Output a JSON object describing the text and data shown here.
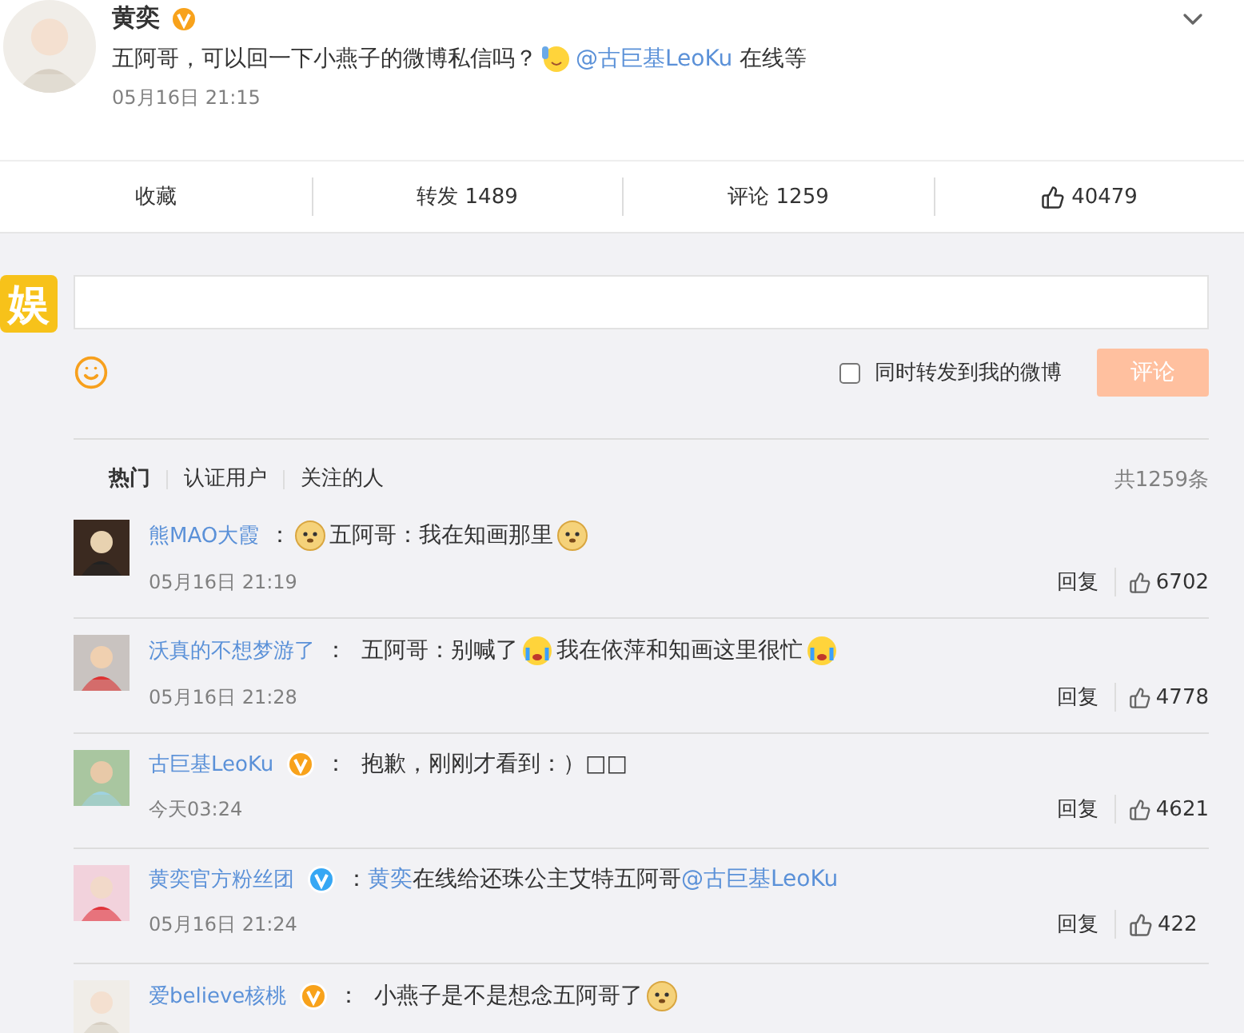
{
  "post": {
    "author": "黄奕",
    "verified": true,
    "color": "#f8a21b",
    "parts": [
      {
        "kind": "text",
        "text": "五阿哥，可以回一下小燕子的微博私信吗？"
      },
      {
        "kind": "wave"
      },
      {
        "kind": "mention",
        "text": "@古巨基LeoKu"
      },
      {
        "kind": "text",
        "text": " 在线等"
      }
    ],
    "time": "05月16日 21:15"
  },
  "actions": [
    {
      "kind": "text",
      "label": "收藏"
    },
    {
      "kind": "text",
      "label": "转发 1489"
    },
    {
      "kind": "text",
      "label": "评论 1259"
    },
    {
      "kind": "like",
      "label": "40479"
    }
  ],
  "composer": {
    "logo": "娱",
    "share_label": "同时转发到我的微博",
    "share_checked": false,
    "submit": "评论"
  },
  "filters": [
    {
      "label": "热门",
      "selected": true
    },
    {
      "label": "认证用户",
      "selected": false
    },
    {
      "label": "关注的人",
      "selected": false
    }
  ],
  "total": "共1259条",
  "comments": [
    {
      "name": "熊MAO大霞",
      "verified": false,
      "parts": [
        {
          "kind": "text",
          "text": "："
        },
        {
          "kind": "doge"
        },
        {
          "kind": "text",
          "text": "五阿哥：我在知画那里"
        },
        {
          "kind": "doge"
        }
      ],
      "time": "05月16日 21:19",
      "reply": "回复",
      "likes": "6702"
    },
    {
      "name": "沃真的不想梦游了",
      "verified": false,
      "parts": [
        {
          "kind": "text",
          "text": "：  五阿哥：别喊了"
        },
        {
          "kind": "cry"
        },
        {
          "kind": "text",
          "text": "我在依萍和知画这里很忙"
        },
        {
          "kind": "cry"
        }
      ],
      "time": "05月16日 21:28",
      "reply": "回复",
      "likes": "4778"
    },
    {
      "name": "古巨基LeoKu",
      "verified": true,
      "color": "#f8a21b",
      "parts": [
        {
          "kind": "text",
          "text": "：  抱歉，刚刚才看到：）□□"
        }
      ],
      "time": "今天03:24",
      "reply": "回复",
      "likes": "4621"
    },
    {
      "name": "黄奕官方粉丝团",
      "verified": true,
      "color": "#36a7f4",
      "parts": [
        {
          "kind": "text",
          "text": "："
        },
        {
          "kind": "mention",
          "text": "黄奕"
        },
        {
          "kind": "text",
          "text": "在线给还珠公主艾特五阿哥"
        },
        {
          "kind": "mention",
          "text": "@古巨基LeoKu"
        }
      ],
      "time": "05月16日 21:24",
      "reply": "回复",
      "likes": "422"
    },
    {
      "name": "爱believe核桃",
      "verified": true,
      "color": "#f8a21b",
      "parts": [
        {
          "kind": "text",
          "text": "：  小燕子是不是想念五阿哥了"
        },
        {
          "kind": "doge"
        }
      ]
    }
  ]
}
